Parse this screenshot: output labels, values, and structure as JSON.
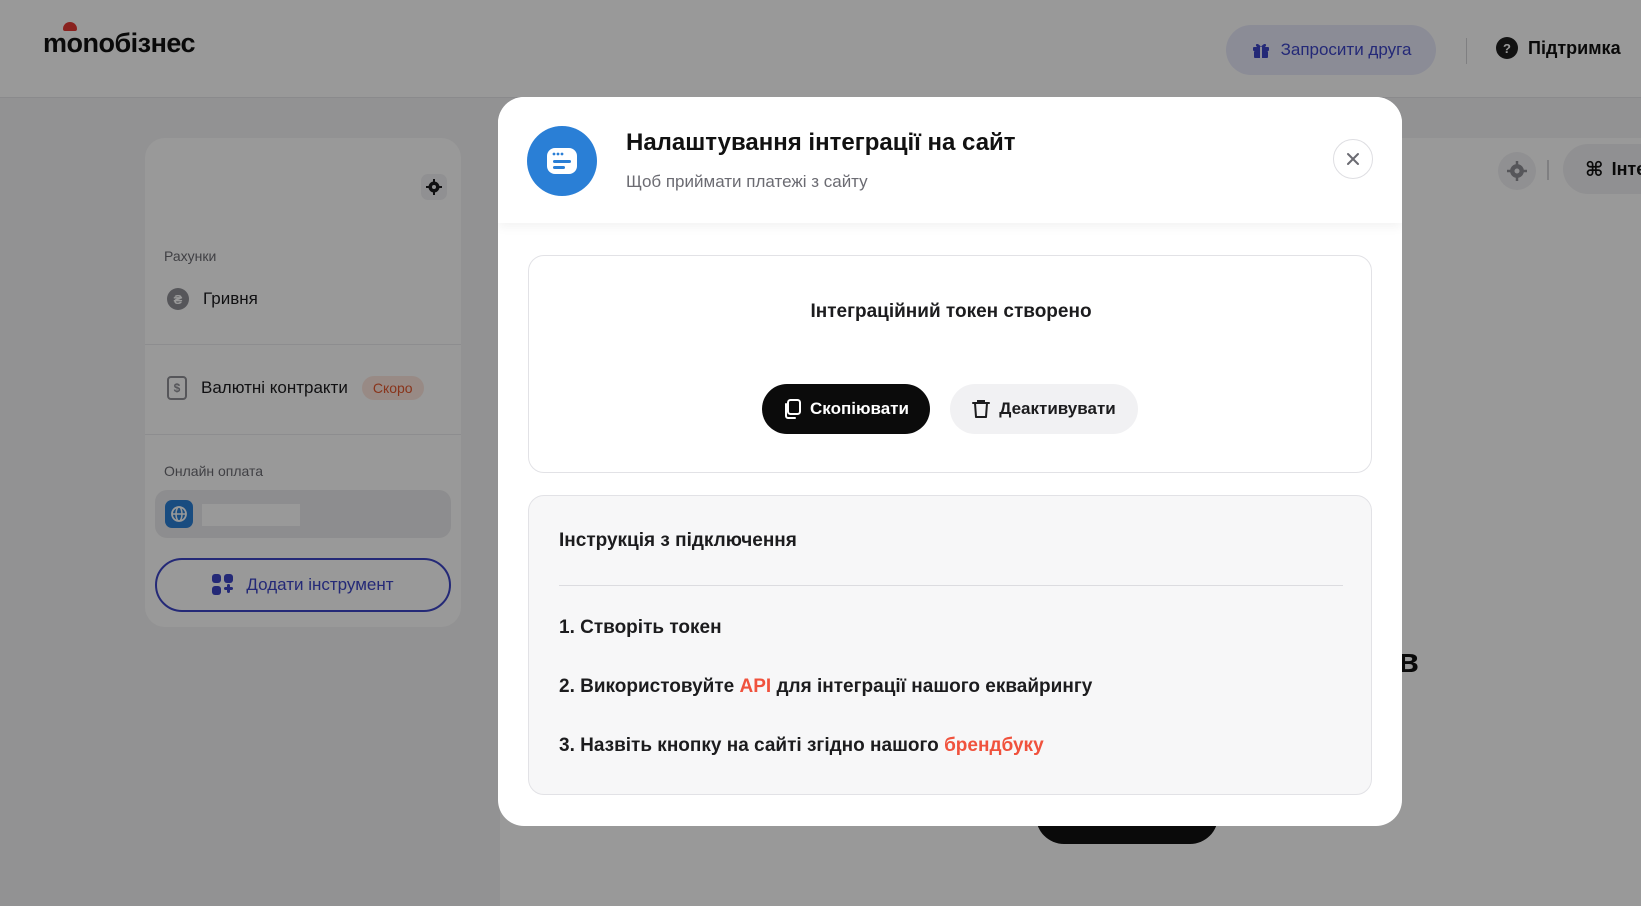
{
  "app": {
    "logo": "monoбізнес",
    "invite_label": "Запросити друга",
    "support_label": "Підтримка",
    "support_icon": "?",
    "main_chip_label": "Інте",
    "main_big_letter": "в"
  },
  "sidebar": {
    "accounts_label": "Рахунки",
    "hryvnia_label": "Гривня",
    "hryvnia_icon": "₴",
    "contracts_label": "Валютні контракти",
    "contracts_icon": "$",
    "soon_badge": "Скоро",
    "online_label": "Онлайн оплата",
    "add_tool_label": "Додати інструмент"
  },
  "modal": {
    "title": "Налаштування інтеграції на сайт",
    "subtitle": "Щоб приймати платежі з сайту",
    "close_icon": "×",
    "token": {
      "title": "Інтеграційний токен створено",
      "copy_label": "Скопіювати",
      "deactivate_label": "Деактивувати"
    },
    "instructions": {
      "title": "Інструкція з підключення",
      "step1": "1. Створіть токен",
      "step2_prefix": "2. Використовуйте ",
      "step2_link": "API",
      "step2_suffix": " для інтеграції нашого еквайрингу",
      "step3_prefix": "3. Назвіть кнопку на сайті згідно нашого ",
      "step3_link": "брендбуку"
    }
  },
  "colors": {
    "accent": "#3c45c7",
    "brand_blue": "#2a7fd6",
    "link_red": "#f0523d",
    "overlay": "rgba(0,0,0,0.4)"
  }
}
